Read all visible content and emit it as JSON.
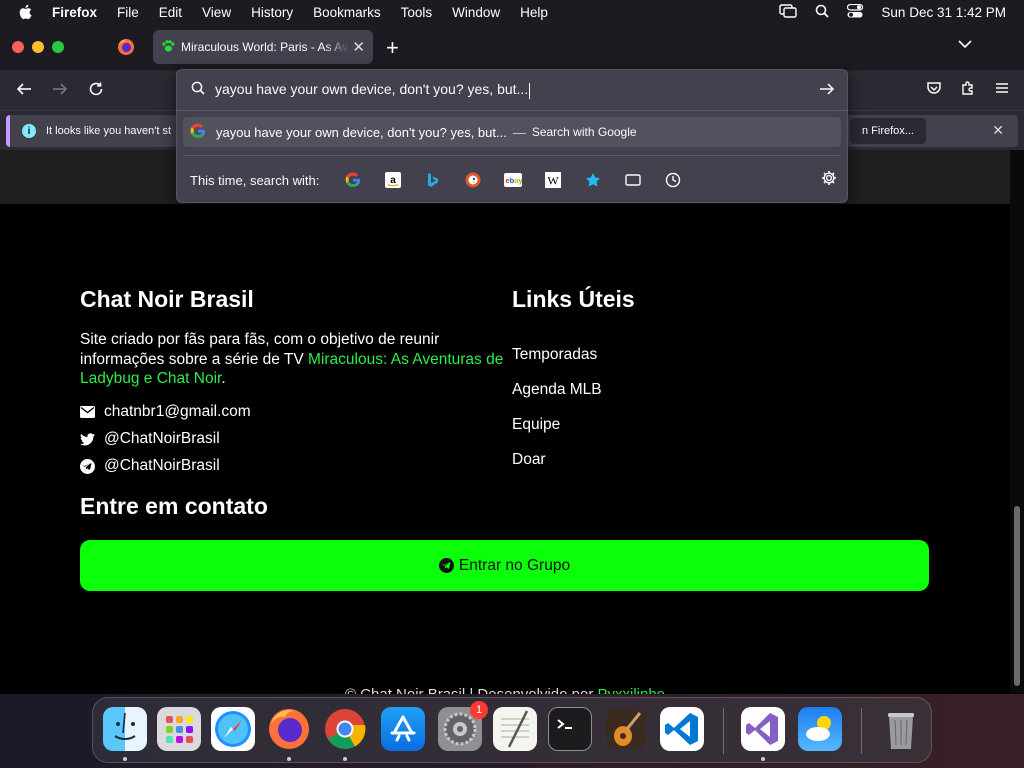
{
  "menubar": {
    "app_name": "Firefox",
    "items": [
      "File",
      "Edit",
      "View",
      "History",
      "Bookmarks",
      "Tools",
      "Window",
      "Help"
    ],
    "clock": "Sun Dec 31  1:42 PM"
  },
  "tabs": {
    "active_title": "Miraculous World: Paris - As Aventuras"
  },
  "url_panel": {
    "query": "yayou have your own device, don't you? yes, but...",
    "suggestion_text": "yayou have your own device, don't you? yes, but...",
    "suggestion_separator": "—",
    "suggestion_action": "Search with Google",
    "engines_label": "This time, search with:",
    "engines": [
      "google-icon",
      "amazon-icon",
      "bing-icon",
      "duckduckgo-icon",
      "ebay-icon",
      "wikipedia-icon",
      "bookmarks-icon",
      "tabs-icon",
      "history-icon"
    ]
  },
  "notification": {
    "text": "It looks like you haven't st",
    "button": "n Firefox..."
  },
  "footer": {
    "brand_title": "Chat Noir Brasil",
    "description_prefix": "Site criado por fãs para fãs, com o objetivo de reunir informações sobre a série de TV ",
    "description_highlight": "Miraculous: As Aventuras de Ladybug e Chat Noir",
    "description_suffix": ".",
    "email": "chatnbr1@gmail.com",
    "twitter": "@ChatNoirBrasil",
    "telegram": "@ChatNoirBrasil",
    "contact_title": "Entre em contato",
    "links_title": "Links Úteis",
    "links": [
      "Temporadas",
      "Agenda MLB",
      "Equipe",
      "Doar"
    ],
    "cta_label": "Entrar no Grupo",
    "copyright_prefix": "© Chat Noir Brasil | Desenvolvido por ",
    "copyright_author": "Pyxxilinho"
  },
  "dock": {
    "apps": [
      "finder-icon",
      "launchpad-icon",
      "safari-icon",
      "firefox-icon",
      "chrome-icon",
      "app-store-icon",
      "system-settings-icon",
      "textedit-icon",
      "terminal-icon",
      "garageband-icon",
      "vscode-icon",
      "visual-studio-icon",
      "weather-icon",
      "trash-icon"
    ],
    "settings_badge": "1"
  },
  "colors": {
    "accent_green": "#2dec4a",
    "cta_green": "#0bff0b",
    "background": "#000000"
  }
}
